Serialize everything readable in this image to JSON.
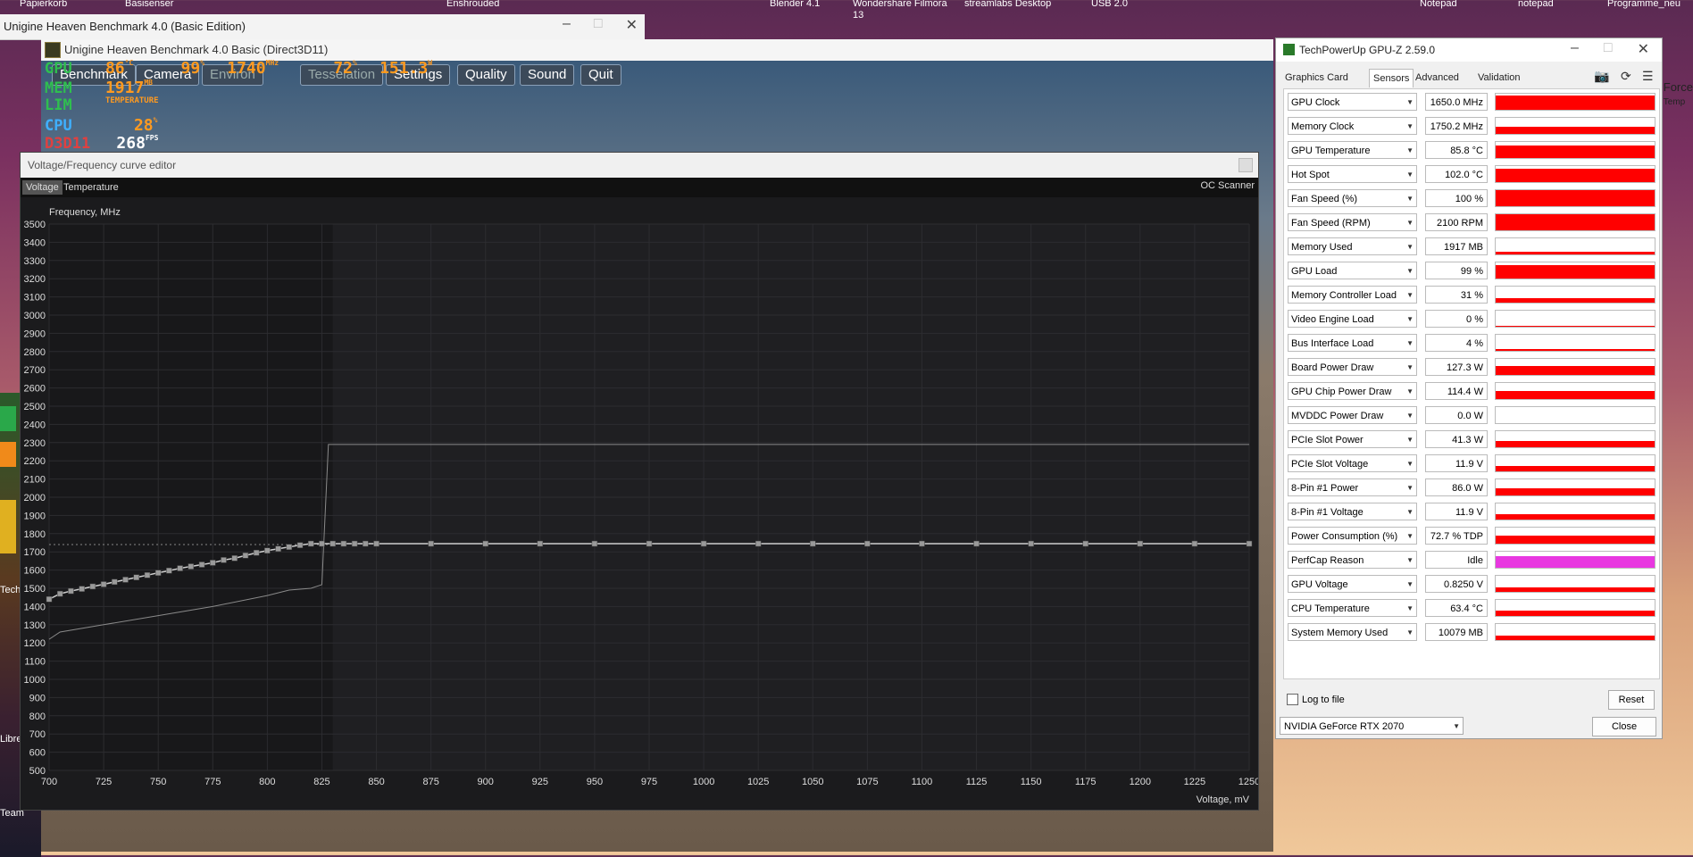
{
  "desktop": {
    "top_labels": [
      "Papierkorb",
      "Basisenser",
      "Enshrouded",
      "Blender 4.1",
      "Wondershare Filmora 13",
      "streamlabs Desktop",
      "USB 2.0",
      "Notepad",
      "notepad",
      "Programme_neu"
    ],
    "side_labels": [
      "Tech",
      "Libre",
      "Team"
    ],
    "right_peek": "Force",
    "right_peek_sub": "Temp"
  },
  "heaven_outer": {
    "title": "Unigine Heaven Benchmark 4.0 (Basic Edition)"
  },
  "heaven_inner": {
    "title": "Unigine Heaven Benchmark 4.0 Basic (Direct3D11)",
    "menu": [
      "Benchmark",
      "Camera",
      "Environ",
      "Tesselation",
      "Settings",
      "Quality",
      "Sound",
      "Quit"
    ]
  },
  "osd": {
    "gpu": {
      "label": "GPU",
      "v1": "86",
      "u1": "°C",
      "v2": "99",
      "u2": "%",
      "v3": "1740",
      "u3": "MHz",
      "v4": "72",
      "u4": "%",
      "v5": "151.3",
      "u5": "W"
    },
    "mem": {
      "label": "MEM",
      "v1": "1917",
      "u1": "MB"
    },
    "lim": {
      "label": "LIM",
      "text": "TEMPERATURE"
    },
    "cpu": {
      "label": "CPU",
      "v1": "28",
      "u1": "%"
    },
    "d3d": {
      "label": "D3D11",
      "v1": "268",
      "u1": "FPS"
    }
  },
  "vf_editor": {
    "title": "Voltage/Frequency curve editor",
    "tabs": [
      "Voltage",
      "Temperature"
    ],
    "oc_scanner": "OC Scanner"
  },
  "chart_data": {
    "type": "line",
    "title": "",
    "ylabel": "Frequency, MHz",
    "xlabel": "Voltage, mV",
    "xlim": [
      700,
      1250
    ],
    "ylim": [
      500,
      3500
    ],
    "x_ticks": [
      700,
      725,
      750,
      775,
      800,
      825,
      850,
      875,
      900,
      925,
      950,
      975,
      1000,
      1025,
      1050,
      1075,
      1100,
      1125,
      1150,
      1175,
      1200,
      1225,
      1250
    ],
    "y_ticks": [
      500,
      600,
      700,
      800,
      900,
      1000,
      1100,
      1200,
      1300,
      1400,
      1500,
      1600,
      1700,
      1800,
      1900,
      2000,
      2100,
      2200,
      2300,
      2400,
      2500,
      2600,
      2700,
      2800,
      2900,
      3000,
      3100,
      3200,
      3300,
      3400,
      3500
    ],
    "grid": true,
    "series": [
      {
        "x": [
          700,
          705,
          710,
          715,
          720,
          725,
          730,
          735,
          740,
          745,
          750,
          755,
          760,
          765,
          770,
          775,
          780,
          785,
          790,
          795,
          800,
          805,
          810,
          815,
          820,
          825,
          830,
          835,
          840,
          845,
          850,
          875,
          900,
          925,
          950,
          975,
          1000,
          1025,
          1050,
          1075,
          1100,
          1125,
          1150,
          1175,
          1200,
          1225,
          1250
        ],
        "y": [
          1440,
          1470,
          1485,
          1497,
          1510,
          1522,
          1535,
          1547,
          1560,
          1572,
          1585,
          1597,
          1610,
          1620,
          1630,
          1640,
          1655,
          1665,
          1680,
          1695,
          1707,
          1717,
          1727,
          1737,
          1745,
          1745,
          1745,
          1745,
          1745,
          1745,
          1745,
          1745,
          1745,
          1745,
          1745,
          1745,
          1745,
          1745,
          1745,
          1745,
          1745,
          1745,
          1745,
          1745,
          1745,
          1745,
          1745
        ]
      },
      {
        "x": [
          700,
          705,
          725,
          750,
          775,
          800,
          810,
          820,
          825,
          828,
          1250
        ],
        "y": [
          1220,
          1260,
          1300,
          1350,
          1400,
          1460,
          1490,
          1500,
          1520,
          2290,
          2290
        ]
      }
    ],
    "reference_line_y": 1740
  },
  "gpuz": {
    "title": "TechPowerUp GPU-Z 2.59.0",
    "tabs": [
      "Graphics Card",
      "Sensors",
      "Advanced",
      "Validation"
    ],
    "active_tab": "Sensors",
    "sensors": [
      {
        "name": "GPU Clock",
        "value": "1650.0 MHz",
        "level": 0.9
      },
      {
        "name": "Memory Clock",
        "value": "1750.2 MHz",
        "level": 0.45
      },
      {
        "name": "GPU Temperature",
        "value": "85.8 °C",
        "level": 0.8
      },
      {
        "name": "Hot Spot",
        "value": "102.0 °C",
        "level": 0.85
      },
      {
        "name": "Fan Speed (%)",
        "value": "100 %",
        "level": 1.0
      },
      {
        "name": "Fan Speed (RPM)",
        "value": "2100 RPM",
        "level": 1.0
      },
      {
        "name": "Memory Used",
        "value": "1917 MB",
        "level": 0.15
      },
      {
        "name": "GPU Load",
        "value": "99 %",
        "level": 0.85
      },
      {
        "name": "Memory Controller Load",
        "value": "31 %",
        "level": 0.3
      },
      {
        "name": "Video Engine Load",
        "value": "0 %",
        "level": 0.05
      },
      {
        "name": "Bus Interface Load",
        "value": "4 %",
        "level": 0.1
      },
      {
        "name": "Board Power Draw",
        "value": "127.3 W",
        "level": 0.55
      },
      {
        "name": "GPU Chip Power Draw",
        "value": "114.4 W",
        "level": 0.5
      },
      {
        "name": "MVDDC Power Draw",
        "value": "0.0 W",
        "level": 0.0
      },
      {
        "name": "PCIe Slot Power",
        "value": "41.3 W",
        "level": 0.4
      },
      {
        "name": "PCIe Slot Voltage",
        "value": "11.9 V",
        "level": 0.35
      },
      {
        "name": "8-Pin #1 Power",
        "value": "86.0 W",
        "level": 0.45
      },
      {
        "name": "8-Pin #1 Voltage",
        "value": "11.9 V",
        "level": 0.35
      },
      {
        "name": "Power Consumption (%)",
        "value": "72.7 % TDP",
        "level": 0.5
      },
      {
        "name": "PerfCap Reason",
        "value": "Idle",
        "level": 0.75,
        "color": "#e838e0"
      },
      {
        "name": "GPU Voltage",
        "value": "0.8250 V",
        "level": 0.3
      },
      {
        "name": "CPU Temperature",
        "value": "63.4 °C",
        "level": 0.35
      },
      {
        "name": "System Memory Used",
        "value": "10079 MB",
        "level": 0.3
      }
    ],
    "log_to_file": "Log to file",
    "reset": "Reset",
    "gpu_name": "NVIDIA GeForce RTX 2070",
    "close": "Close",
    "graph_color": "#ff0000"
  }
}
